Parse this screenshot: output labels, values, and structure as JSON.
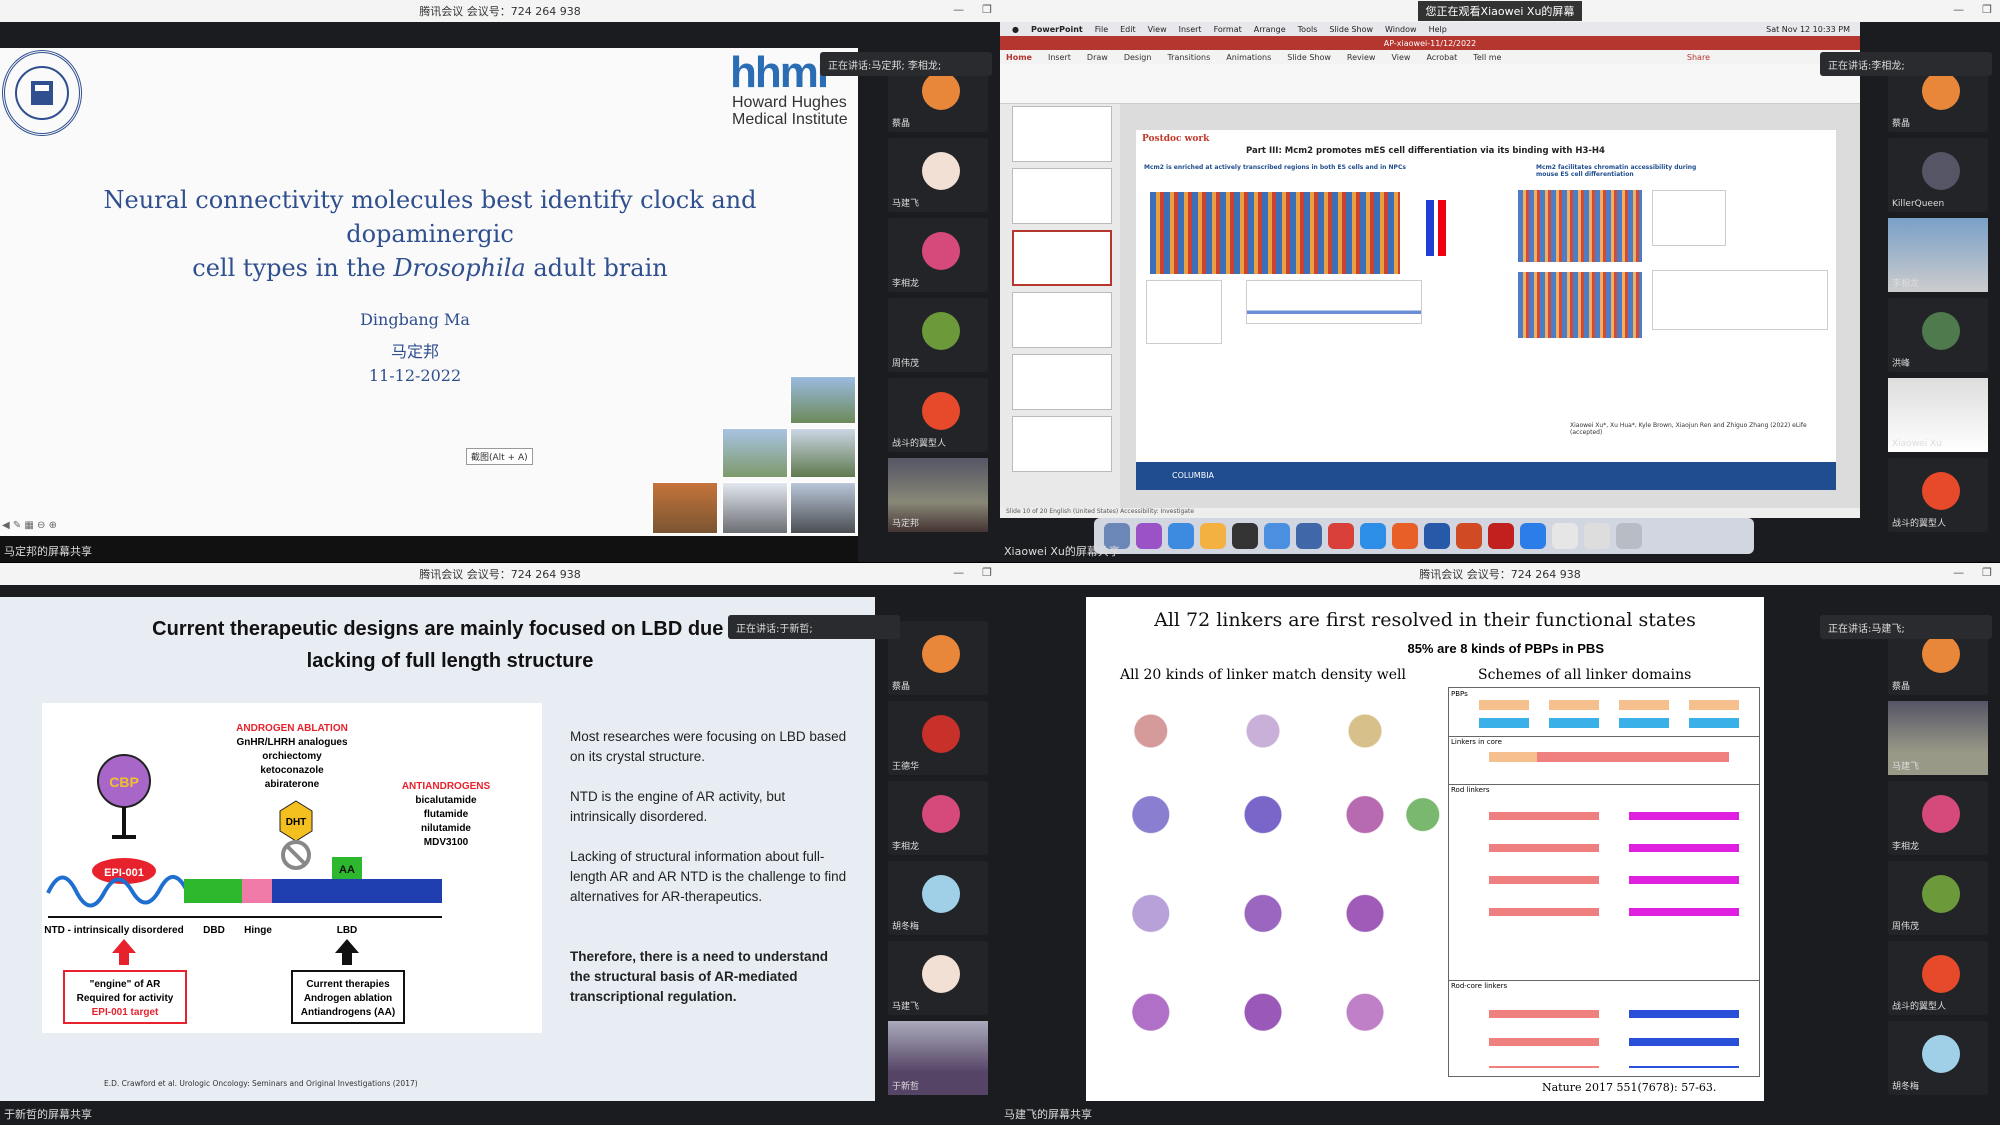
{
  "meeting_title": "腾讯会议 会议号：724 264 938",
  "speaking_prefix": "正在讲话: ",
  "q1": {
    "share_label": "马定邦的屏幕共享",
    "speaking": "马定邦; 李相龙;",
    "slide": {
      "logo": "hhmi",
      "logo_sub1": "Howard Hughes",
      "logo_sub2": "Medical Institute",
      "title_a": "Neural connectivity molecules best identify clock and dopaminergic",
      "title_b": "cell types in the ",
      "title_italic": "Drosophila",
      "title_c": " adult brain",
      "author_en": "Dingbang Ma",
      "author_cn": "马定邦",
      "date": "11-12-2022",
      "screenshot_hint": "截图(Alt + A)"
    },
    "participants": [
      "蔡晶",
      "马建飞",
      "李相龙",
      "周伟茂",
      "战斗的翼型人",
      "马定邦"
    ]
  },
  "q2": {
    "share_label": "Xiaowei Xu的屏幕共享",
    "banner": "您正在观看Xiaowei Xu的屏幕",
    "speaking": "李相龙;",
    "menubar": [
      "PowerPoint",
      "File",
      "Edit",
      "View",
      "Insert",
      "Format",
      "Arrange",
      "Tools",
      "Slide Show",
      "Window",
      "Help"
    ],
    "clock": "Sat Nov 12  10:33 PM",
    "doc_title": "AP-xiaowei-11/12/2022",
    "ribbon_tabs": [
      "Home",
      "Insert",
      "Draw",
      "Design",
      "Transitions",
      "Animations",
      "Slide Show",
      "Review",
      "View",
      "Acrobat",
      "Tell me"
    ],
    "share_btn": "Share",
    "slide": {
      "tag": "Postdoc work",
      "title": "Part III: Mcm2 promotes mES cell differentiation via its binding with H3-H4",
      "left_head": "Mcm2 is enriched at actively transcribed regions in both ES cells and in NPCs",
      "right_head": "Mcm2 facilitates chromatin accessibility during mouse ES cell differentiation",
      "cite": "Xiaowei Xu*, Xu Hua*, Kyle Brown, Xiaojun Ren and Zhiguo Zhang (2022) eLife (accepted)",
      "footer": "COLUMBIA"
    },
    "status": "Slide 10 of 20   English (United States)   Accessibility: Investigate",
    "participants": [
      "蔡晶",
      "KillerQueen",
      "李相龙",
      "洪峰",
      "Xiaowei Xu",
      "战斗的翼型人"
    ]
  },
  "q3": {
    "share_label": "于新哲的屏幕共享",
    "speaking": "于新哲;",
    "slide": {
      "heading_a": "Current therapeutic designs are mainly focused on LBD due to",
      "heading_b": "lacking of full length structure",
      "cbp": "CBP",
      "epi": "EPI-001",
      "ablation_head": "ANDROGEN ABLATION",
      "ablation_list": [
        "GnHR/LHRH analogues",
        "orchiectomy",
        "ketoconazole",
        "abiraterone"
      ],
      "dht": "DHT",
      "aa": "AA",
      "anti_head": "ANTIANDROGENS",
      "anti_list": [
        "bicalutamide",
        "flutamide",
        "nilutamide",
        "MDV3100"
      ],
      "domains": [
        "NTD - intrinsically disordered",
        "DBD",
        "Hinge",
        "LBD"
      ],
      "engine_box": [
        "\"engine\" of AR",
        "Required for activity",
        "EPI-001 target"
      ],
      "therapy_box": [
        "Current therapies",
        "Androgen ablation",
        "Antiandrogens (AA)"
      ],
      "bullets": [
        "Most researches were focusing on LBD based on its crystal structure.",
        "NTD is the engine of AR activity, but intrinsically disordered.",
        "Lacking of structural information about full-length AR and AR NTD is the challenge to find alternatives for AR-therapeutics.",
        "Therefore, there is a need to understand the structural basis of AR-mediated transcriptional regulation."
      ],
      "cite": "E.D. Crawford et al. Urologic Oncology: Seminars and Original Investigations (2017)"
    },
    "participants": [
      "蔡晶",
      "王德华",
      "李相龙",
      "胡冬梅",
      "马建飞",
      "于新哲"
    ]
  },
  "q4": {
    "share_label": "马建飞的屏幕共享",
    "speaking": "马建飞;",
    "slide": {
      "title": "All 72 linkers are first resolved in their functional states",
      "sub": "85% are 8 kinds of PBPs in PBS",
      "col1": "All 20 kinds of linker match density well",
      "col2": "Schemes of all linker domains",
      "ref": "Nature  2017  551(7678): 57-63.",
      "sec": [
        "PBPs",
        "Linkers in core",
        "Rod linkers",
        "Rod-core linkers"
      ]
    },
    "participants": [
      "蔡晶",
      "马建飞",
      "李相龙",
      "周伟茂",
      "战斗的翼型人",
      "胡冬梅"
    ]
  },
  "colors": {
    "accent_red": "#e8222c",
    "slide_blue": "#2f4f8f",
    "ppt_red": "#b5352f"
  }
}
